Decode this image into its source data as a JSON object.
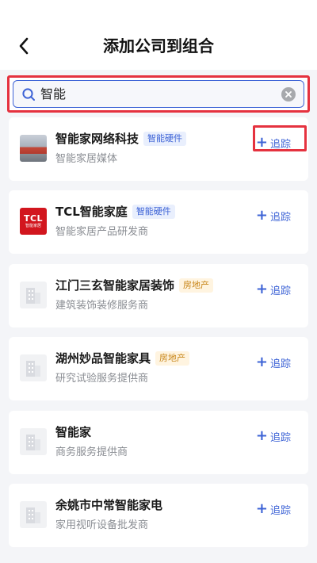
{
  "header": {
    "title": "添加公司到组合"
  },
  "search": {
    "value": "智能"
  },
  "companies": [
    {
      "name": "智能家网络科技",
      "tag": "智能硬件",
      "desc": "智能家居媒体",
      "action": "追踪"
    },
    {
      "name": "TCL智能家庭",
      "tag": "智能硬件",
      "desc": "智能家居产品研发商",
      "action": "追踪",
      "logo_text": "TCL",
      "logo_sub": "智能家居"
    },
    {
      "name": "江门三玄智能家居装饰",
      "tag": "房地产",
      "desc": "建筑装饰装修服务商",
      "action": "追踪"
    },
    {
      "name": "湖州妙品智能家具",
      "tag": "房地产",
      "desc": "研究试验服务提供商",
      "action": "追踪"
    },
    {
      "name": "智能家",
      "tag": "",
      "desc": "商务服务提供商",
      "action": "追踪"
    },
    {
      "name": "余姚市中常智能家电",
      "tag": "",
      "desc": "家用视听设备批发商",
      "action": "追踪"
    }
  ],
  "colors": {
    "accent": "#3d63d6",
    "highlight": "#e5323f",
    "tag_yellow": "#c8861a"
  },
  "icons": {
    "back": "chevron-left-icon",
    "search": "search-icon",
    "clear": "clear-icon",
    "add": "plus-icon",
    "building": "building-icon"
  }
}
